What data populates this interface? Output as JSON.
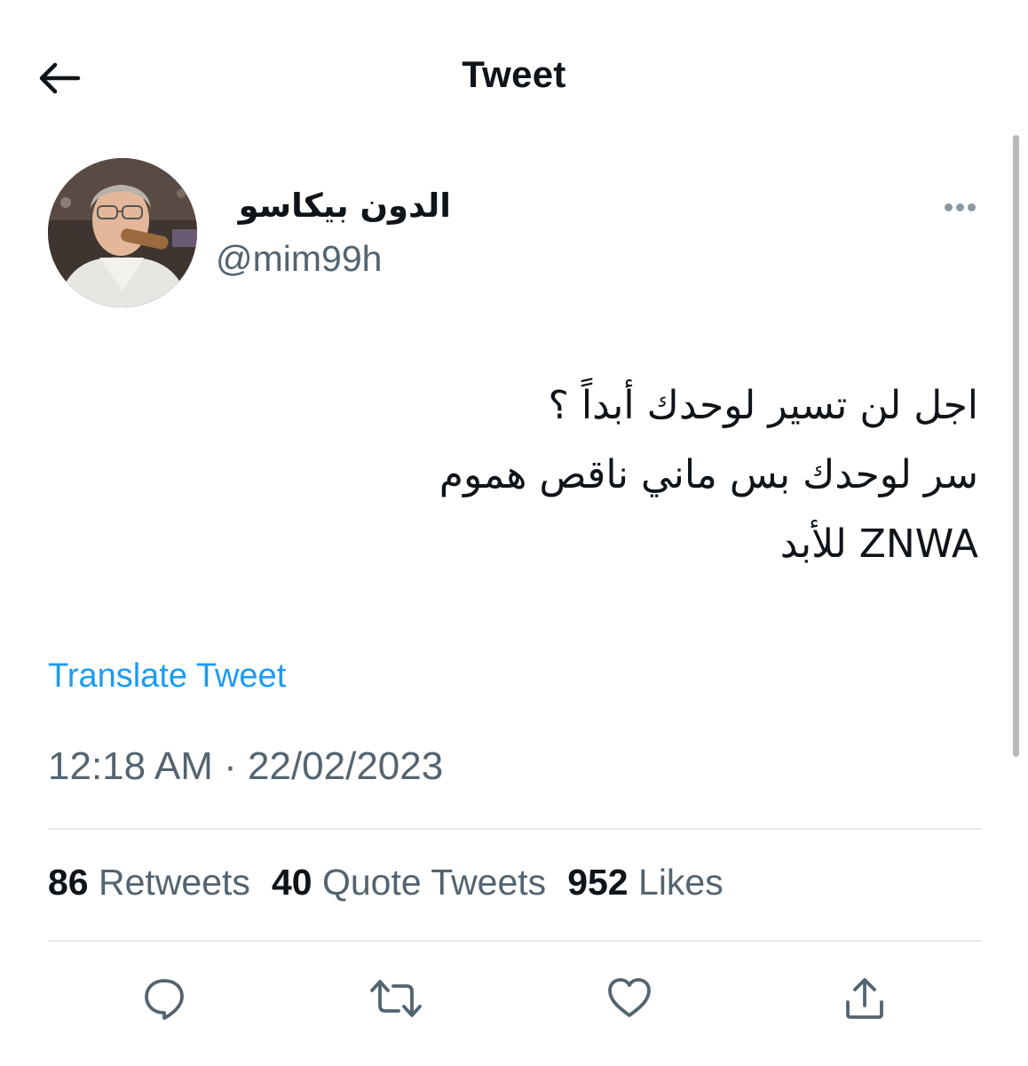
{
  "header": {
    "title": "Tweet"
  },
  "tweet": {
    "author_name": "الدون بيكاسو",
    "author_handle": "@mim99h",
    "text": "اجل لن تسير لوحدك أبداً ؟\nسر لوحدك بس ماني ناقص هموم\nZNWA للأبد",
    "translate_label": "Translate Tweet",
    "timestamp": "12:18 AM · 22/02/2023"
  },
  "stats": {
    "retweets_count": "86",
    "retweets_label": "Retweets",
    "quotes_count": "40",
    "quotes_label": "Quote Tweets",
    "likes_count": "952",
    "likes_label": "Likes"
  },
  "icons": {
    "back": "arrow-left-icon",
    "more": "more-dots-icon",
    "reply": "comment-icon",
    "retweet": "retweet-icon",
    "like": "heart-icon",
    "share": "share-icon"
  },
  "colors": {
    "link": "#1d9bf0",
    "secondary_text": "#536471",
    "primary_text": "#0f1419",
    "divider": "#e7e9eb"
  }
}
